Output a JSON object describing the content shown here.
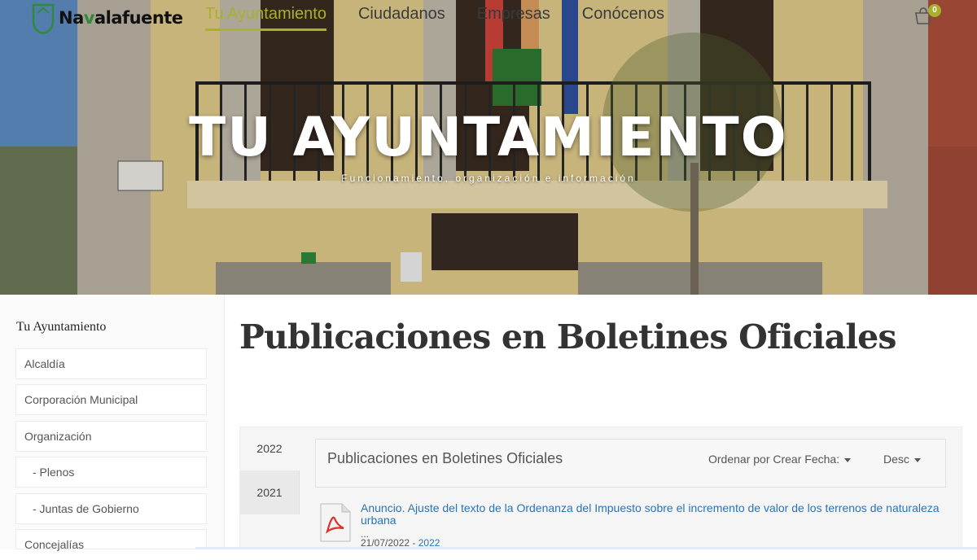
{
  "brand": {
    "name_pre": "Na",
    "name_mid": "v",
    "name_post": "alafuente"
  },
  "nav": [
    {
      "label": "Tu Ayuntamiento",
      "active": true
    },
    {
      "label": "Ciudadanos"
    },
    {
      "label": "Empresas"
    },
    {
      "label": "Conócenos"
    }
  ],
  "cart": {
    "count": "0"
  },
  "hero": {
    "title": "TU AYUNTAMIENTO",
    "subtitle": "Funcionamiento, organización e información"
  },
  "sidebar": {
    "title": "Tu Ayuntamiento",
    "items": [
      {
        "label": "Alcaldía"
      },
      {
        "label": "Corporación Municipal"
      },
      {
        "label": "Organización"
      },
      {
        "label": "- Plenos"
      },
      {
        "label": "- Juntas de Gobierno"
      },
      {
        "label": "Concejalías"
      }
    ]
  },
  "main": {
    "page_title": "Publicaciones en Boletines Oficiales",
    "years": [
      {
        "label": "2022",
        "selected": false
      },
      {
        "label": "2021",
        "selected": true
      }
    ],
    "list_title": "Publicaciones en Boletines Oficiales",
    "sort_by": "Ordenar por Crear Fecha:",
    "sort_dir": "Desc",
    "publications": [
      {
        "title": "Anuncio. Ajuste del texto de la Ordenanza del Impuesto sobre el incremento de valor de los terrenos de naturaleza urbana",
        "ellipsis": "...",
        "date": "21/07/2022",
        "separator": "-",
        "year": "2022"
      }
    ]
  },
  "colors": {
    "accent": "#a8b02c",
    "link": "#2a74b8",
    "title": "#333333"
  }
}
